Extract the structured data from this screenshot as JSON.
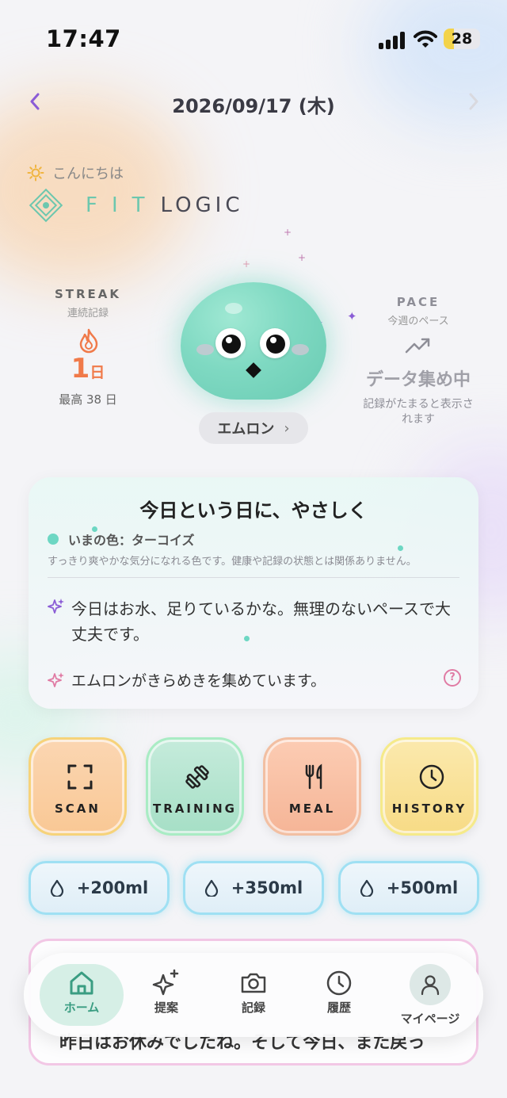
{
  "status_bar": {
    "time": "17:47",
    "battery": "28"
  },
  "header": {
    "date": "2026/09/17 (木)"
  },
  "greeting": {
    "text": "こんにちは",
    "brand_fit": "FIT",
    "brand_logic": "LOGIC"
  },
  "streak": {
    "eyebrow": "STREAK",
    "sub": "連続記録",
    "count": "1",
    "unit": "日",
    "best": "最高 38 日"
  },
  "pace": {
    "eyebrow": "PACE",
    "sub": "今週のペース",
    "status": "データ集め中",
    "note": "記録がたまると表示されます"
  },
  "mascot": {
    "name": "エムロン",
    "chevron": "›"
  },
  "today_card": {
    "title": "今日という日に、やさしく",
    "color_label": "いまの色：ターコイズ",
    "color_note": "すっきり爽やかな気分になれる色です。健康や記録の状態とは関係ありません。",
    "tip": "今日はお水、足りているかな。無理のないペースで大丈夫です。",
    "status": "エムロンがきらめきを集めています。",
    "help": "?"
  },
  "actions": [
    {
      "label": "SCAN",
      "icon": "scan-icon"
    },
    {
      "label": "TRAINING",
      "icon": "dumbbell-icon"
    },
    {
      "label": "MEAL",
      "icon": "fork-knife-icon"
    },
    {
      "label": "HISTORY",
      "icon": "clock-icon"
    }
  ],
  "water": [
    "+200ml",
    "+350ml",
    "+500ml"
  ],
  "next_card": {
    "text": "昨日はお休みでしたね。そして今日、また戻っ"
  },
  "tabs": [
    {
      "label": "ホーム",
      "icon": "home-icon"
    },
    {
      "label": "提案",
      "icon": "sparkles-icon"
    },
    {
      "label": "記録",
      "icon": "camera-icon"
    },
    {
      "label": "履歴",
      "icon": "clock-icon"
    },
    {
      "label": "マイページ",
      "icon": "person-icon"
    }
  ],
  "colors": {
    "accent": "#6dd7c3",
    "streak": "#f07a4a",
    "nav_active": "#3a9d82",
    "purple": "#8b5cd6"
  }
}
